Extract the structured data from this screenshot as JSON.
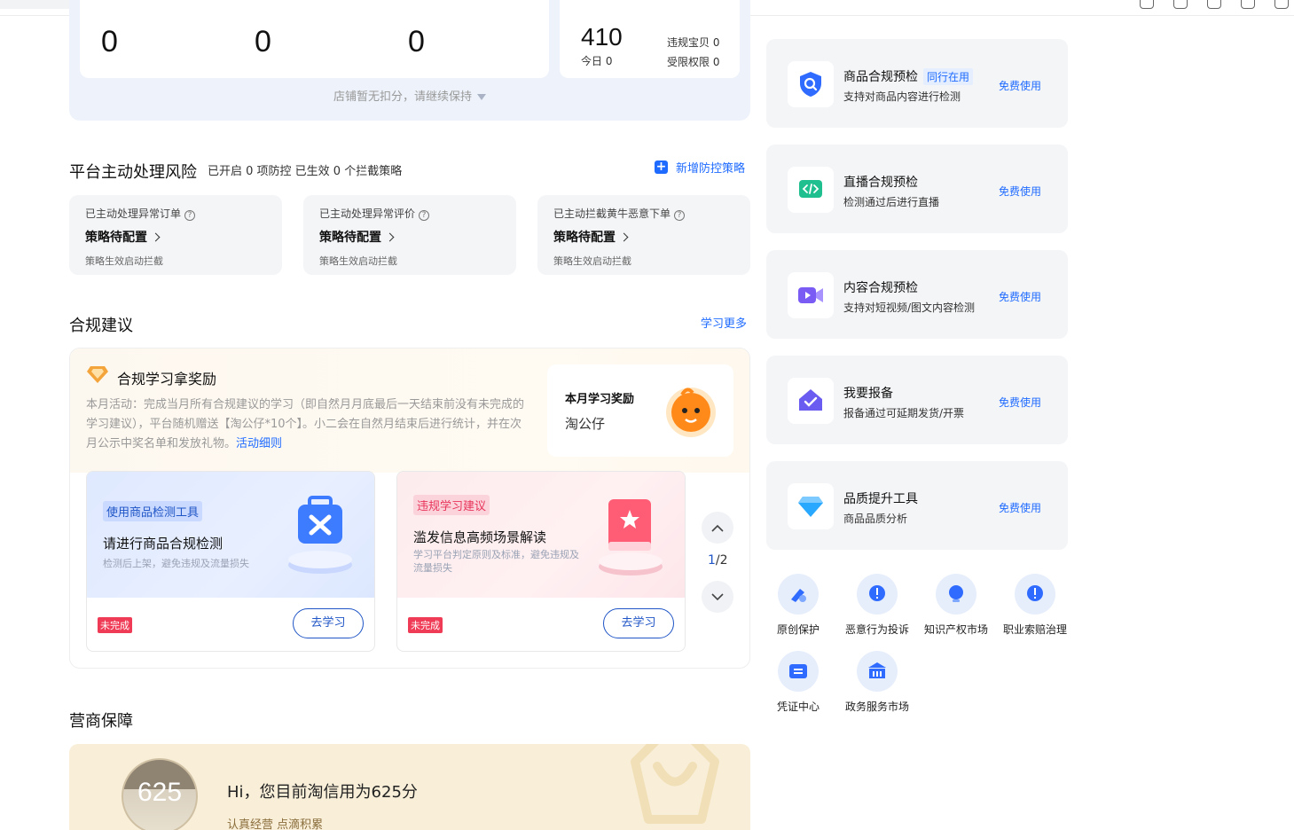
{
  "stats": {
    "values": [
      "0",
      "0",
      "0"
    ],
    "total": "410",
    "today": "今日 0",
    "violation_items": "违规宝贝 0",
    "restricted_rights": "受限权限 0",
    "deduct_note": "店铺暂无扣分，请继续保持"
  },
  "risk": {
    "title": "平台主动处理风险",
    "summary": "已开启 0 项防控 已生效 0 个拦截策略",
    "add_label": "新增防控策略",
    "cards": [
      {
        "title": "已主动处理异常订单",
        "action": "策略待配置",
        "note": "策略生效启动拦截"
      },
      {
        "title": "已主动处理异常评价",
        "action": "策略待配置",
        "note": "策略生效启动拦截"
      },
      {
        "title": "已主动拦截黄牛恶意下单",
        "action": "策略待配置",
        "note": "策略生效启动拦截"
      }
    ]
  },
  "compliance": {
    "title": "合规建议",
    "more_link": "学习更多",
    "reward_title": "合规学习拿奖励",
    "reward_desc": "本月活动：完成当月所有合规建议的学习（即自然月月底最后一天结束前没有未完成的学习建议），平台随机赠送【淘公仔*10个】。小二会在自然月结束后进行统计，并在次月公示中奖名单和发放礼物。",
    "rules_link": "活动细则",
    "award_label": "本月学习奖励",
    "award_name": "淘公仔",
    "tasks": [
      {
        "tag": "使用商品检测工具",
        "title": "请进行商品合规检测",
        "desc": "检测后上架，避免违规及流量损失",
        "status": "未完成",
        "button": "去学习"
      },
      {
        "tag": "违规学习建议",
        "title": "滥发信息高频场景解读",
        "desc": "学习平台判定原则及标准，避免违规及流量损失",
        "status": "未完成",
        "button": "去学习"
      }
    ],
    "page_current": "1",
    "page_sep": "/",
    "page_total": "2"
  },
  "guarantee": {
    "title": "营商保障",
    "score": "625",
    "greeting": "Hi，您目前淘信用为625分",
    "slogan": "认真经营 点滴积累"
  },
  "tools": [
    {
      "name": "商品合规预检",
      "badge": "同行在用",
      "desc": "支持对商品内容进行检测",
      "action": "免费使用",
      "icon": "shield-search-icon",
      "color": "#2f6bff"
    },
    {
      "name": "直播合规预检",
      "badge": "",
      "desc": "检测通过后进行直播",
      "action": "免费使用",
      "icon": "code-screen-icon",
      "color": "#1fbf8f"
    },
    {
      "name": "内容合规预检",
      "badge": "",
      "desc": "支持对短视频/图文内容检测",
      "action": "免费使用",
      "icon": "video-camera-icon",
      "color": "#7a5cf5"
    },
    {
      "name": "我要报备",
      "badge": "",
      "desc": "报备通过可延期发货/开票",
      "action": "免费使用",
      "icon": "house-check-icon",
      "color": "#6a5cf0"
    },
    {
      "name": "品质提升工具",
      "badge": "",
      "desc": "商品品质分析",
      "action": "免费使用",
      "icon": "diamond-icon",
      "color": "#29a8ff"
    }
  ],
  "services": [
    {
      "label": "原创保护",
      "icon": "pen-shield-icon"
    },
    {
      "label": "恶意行为投诉",
      "icon": "alert-chat-icon"
    },
    {
      "label": "知识产权市场",
      "icon": "lightbulb-icon"
    },
    {
      "label": "职业索赔治理",
      "icon": "alert-chat-icon"
    },
    {
      "label": "凭证中心",
      "icon": "ticket-icon"
    },
    {
      "label": "政务服务市场",
      "icon": "government-building-icon"
    }
  ]
}
